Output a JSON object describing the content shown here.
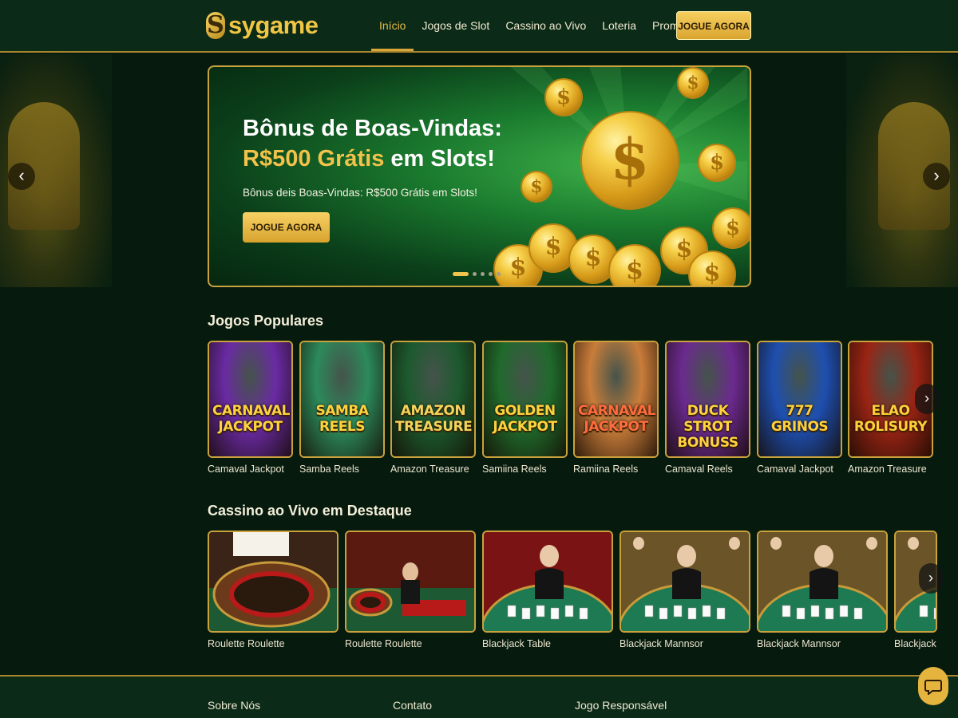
{
  "header": {
    "logo_text": "sygame",
    "nav": [
      "Início",
      "Jogos de Slot",
      "Cassino ao Vivo",
      "Loteria",
      "Promoções"
    ],
    "active_nav": "Início",
    "cta_label": "JOGUE AGORA"
  },
  "hero": {
    "title_line1": "Bônus de Boas-Vindas:",
    "title_line2_gold": "R$500 Grátis",
    "title_line2_rest": " em Slots!",
    "subtitle": "Bônus deis Boas-Vindas: R$500 Grátis em Slots!",
    "button_label": "JOGUE AGORA",
    "coin_symbol": "$",
    "slides_count": 5,
    "active_slide": 1
  },
  "popular": {
    "title": "Jogos Populares",
    "games": [
      {
        "art": "CARNAVAL JACKPOT",
        "name": "Camaval Jackpot",
        "bg": "#6a2aa3",
        "text_color": "#ffd23d"
      },
      {
        "art": "SAMBA REELS",
        "name": "Samba Reels",
        "bg": "#2c8a5b",
        "text_color": "#ffd23d"
      },
      {
        "art": "AMAZON TREASURE",
        "name": "Amazon Treasure",
        "bg": "#1c5a2e",
        "text_color": "#f5d25a"
      },
      {
        "art": "GOLDEN JACKPOT",
        "name": "Samiina Reels",
        "bg": "#1f6a2c",
        "text_color": "#ffd23d"
      },
      {
        "art": "CARNAVAL JACKPOT",
        "name": "Ramiina Reels",
        "bg": "#c97d3a",
        "text_color": "#ff6b3d"
      },
      {
        "art": "DUCK STROT BONUSS",
        "name": "Camaval Reels",
        "bg": "#6b2a8f",
        "text_color": "#ffd23d"
      },
      {
        "art": "777 GRINOS",
        "name": "Camaval Jackpot",
        "bg": "#1e4fb0",
        "text_color": "#ffcf3a"
      },
      {
        "art": "ELAO ROLISURY",
        "name": "Amazon Treasure",
        "bg": "#9a2414",
        "text_color": "#ffcf3a"
      }
    ]
  },
  "live": {
    "title": "Cassino ao Vivo em Destaque",
    "tables": [
      {
        "name": "Roulette Roulette"
      },
      {
        "name": "Roulette Roulette"
      },
      {
        "name": "Blackjack Table"
      },
      {
        "name": "Blackjack Mannsor"
      },
      {
        "name": "Blackjack Mannsor"
      },
      {
        "name": "Blackjack M"
      }
    ]
  },
  "footer": {
    "links": [
      "Sobre Nós",
      "Contato",
      "Jogo Responsável"
    ]
  },
  "icons": {
    "prev": "chevron-left-icon",
    "next": "chevron-right-icon",
    "chat": "chat-icon"
  },
  "colors": {
    "gold": "#f2c24a",
    "background": "#061a0e",
    "header": "#0b2a17"
  }
}
